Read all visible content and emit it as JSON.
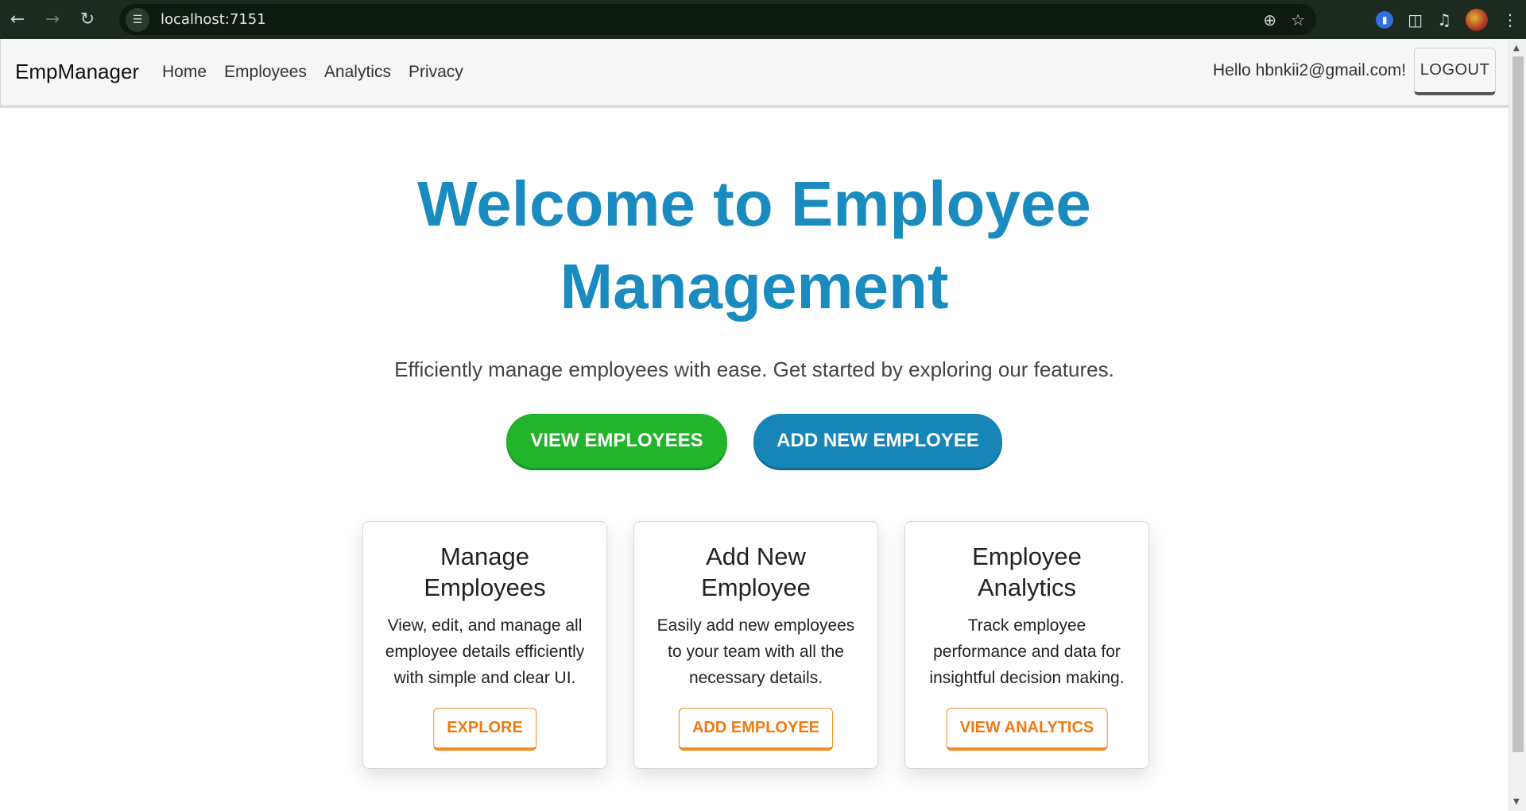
{
  "browser": {
    "url": "localhost:7151",
    "icons": {
      "back": "back-arrow-icon",
      "forward": "forward-arrow-icon",
      "reload": "reload-icon",
      "site_info": "tune-icon",
      "zoom": "zoom-icon",
      "bookmark": "star-icon",
      "extension": "bookmark-extension-icon",
      "extensions": "puzzle-icon",
      "media": "media-queue-icon",
      "menu": "kebab-menu-icon"
    }
  },
  "navbar": {
    "brand": "EmpManager",
    "links": [
      "Home",
      "Employees",
      "Analytics",
      "Privacy"
    ],
    "greeting": "Hello hbnkii2@gmail.com!",
    "logout_label": "LOGOUT"
  },
  "hero": {
    "title_line1": "Welcome to Employee",
    "title_line2": "Management",
    "subtitle": "Efficiently manage employees with ease. Get started by exploring our features.",
    "primary_button": "VIEW EMPLOYEES",
    "secondary_button": "ADD NEW EMPLOYEE"
  },
  "cards": [
    {
      "title": "Manage Employees",
      "text": "View, edit, and manage all employee details efficiently with simple and clear UI.",
      "button": "EXPLORE"
    },
    {
      "title": "Add New Employee",
      "text": "Easily add new employees to your team with all the necessary details.",
      "button": "ADD EMPLOYEE"
    },
    {
      "title": "Employee Analytics",
      "text": "Track employee performance and data for insightful decision making.",
      "button": "VIEW ANALYTICS"
    }
  ],
  "colors": {
    "hero_title": "#1a8bbf",
    "green_button": "#22b42b",
    "blue_button": "#1785b8",
    "card_accent": "#f28b24"
  }
}
